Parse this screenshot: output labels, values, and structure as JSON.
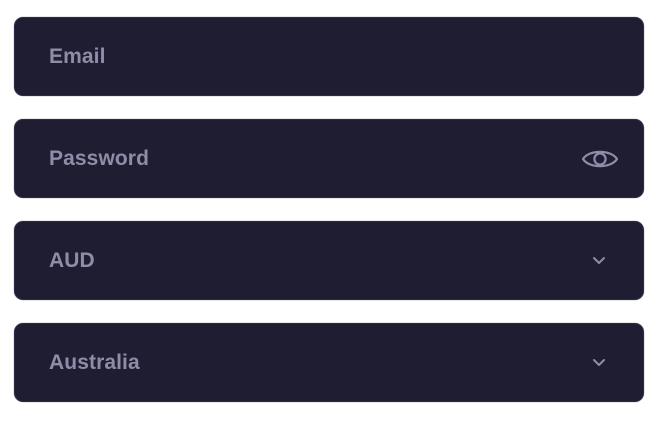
{
  "form": {
    "email": {
      "placeholder": "Email",
      "icon": "none"
    },
    "password": {
      "placeholder": "Password",
      "icon": "eye-icon"
    },
    "currency": {
      "selected": "AUD",
      "icon": "chevron-down-icon"
    },
    "country": {
      "selected": "Australia",
      "icon": "chevron-down-icon"
    }
  },
  "colors": {
    "field_background": "#1e1d31",
    "text": "#8e8da8",
    "page_background": "#ffffff"
  }
}
